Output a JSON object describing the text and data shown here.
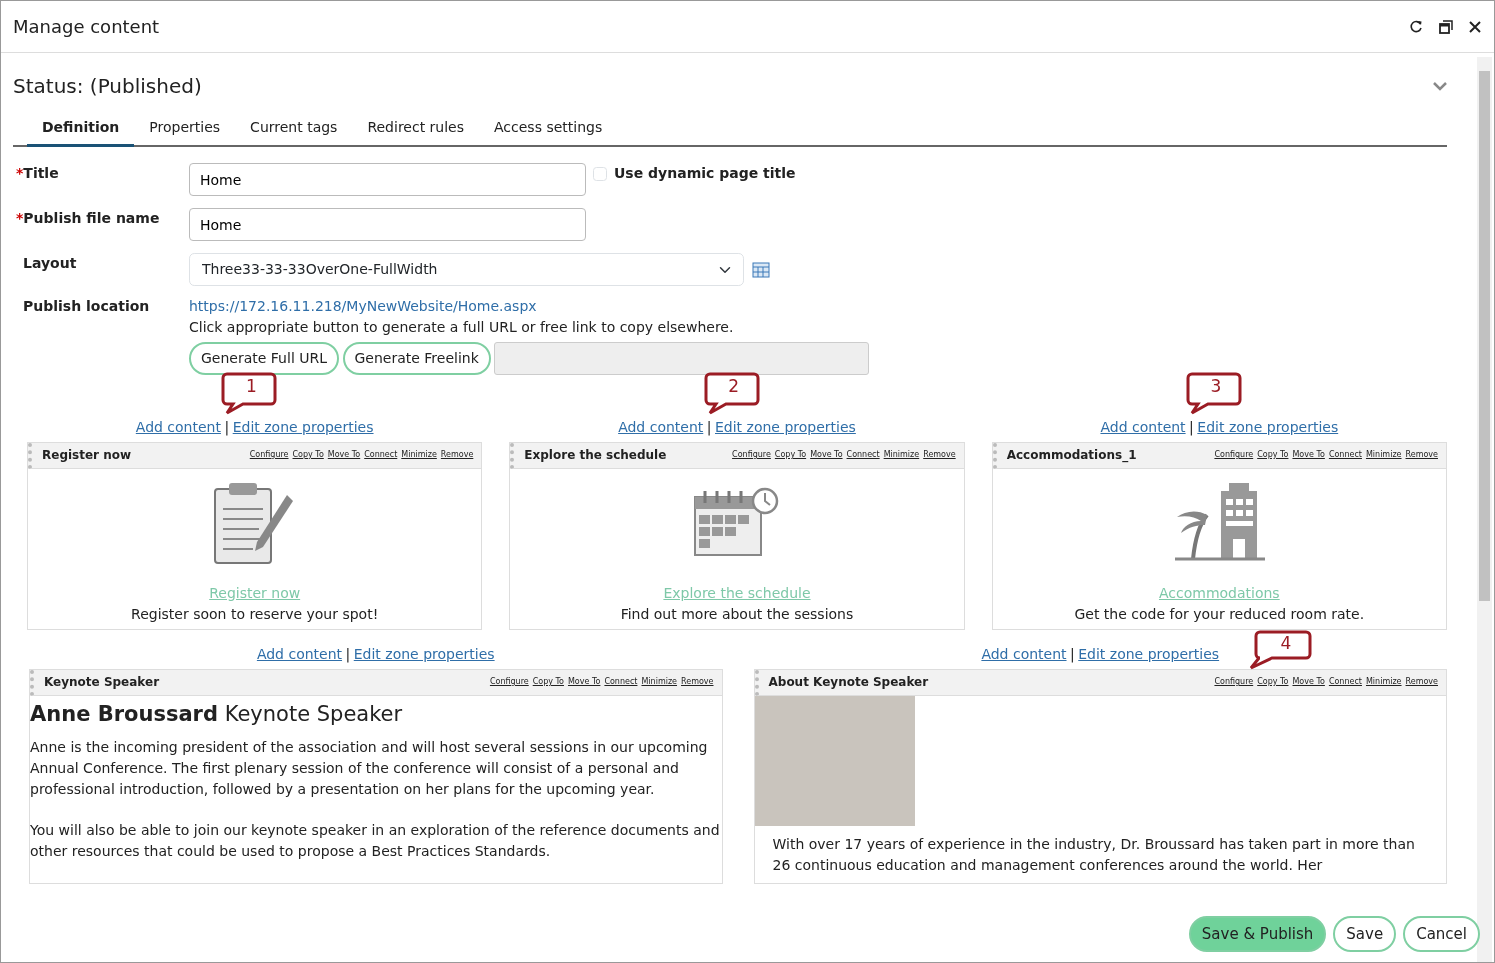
{
  "window": {
    "title": "Manage content"
  },
  "status": {
    "title": "Status: (Published)"
  },
  "tabs": [
    {
      "label": "Definition",
      "selected": true
    },
    {
      "label": "Properties",
      "selected": false
    },
    {
      "label": "Current tags",
      "selected": false
    },
    {
      "label": "Redirect rules",
      "selected": false
    },
    {
      "label": "Access settings",
      "selected": false
    }
  ],
  "form": {
    "title": {
      "required_mark": "*",
      "label": "Title",
      "value": "Home"
    },
    "dynamic_title": {
      "label": "Use dynamic page title",
      "checked": false
    },
    "publish_file_name": {
      "required_mark": "*",
      "label": "Publish file name",
      "value": "Home"
    },
    "layout": {
      "label": "Layout",
      "value": "Three33-33-33OverOne-FullWidth"
    },
    "publish_location": {
      "label": "Publish location",
      "url": "https://172.16.11.218/MyNewWebsite/Home.aspx",
      "hint": "Click appropriate button to generate a full URL or free link to copy elsewhere.",
      "buttons": [
        "Generate Full URL",
        "Generate Freelink"
      ]
    }
  },
  "top_zones": [
    {
      "links": [
        "Add content",
        "Edit zone properties"
      ],
      "separator": "|",
      "callout": "1",
      "webpart": {
        "title": "Register now",
        "actions": [
          "Configure",
          "Copy To",
          "Move To",
          "Connect",
          "Minimize",
          "Remove"
        ],
        "kind": "clipboard",
        "link": "Register now",
        "description": "Register soon to reserve your spot!"
      }
    },
    {
      "links": [
        "Add content",
        "Edit zone properties"
      ],
      "separator": "|",
      "callout": "2",
      "webpart": {
        "title": "Explore the schedule",
        "actions": [
          "Configure",
          "Copy To",
          "Move To",
          "Connect",
          "Minimize",
          "Remove"
        ],
        "kind": "calendar",
        "link": "Explore the schedule",
        "description": "Find out more about the sessions"
      }
    },
    {
      "links": [
        "Add content",
        "Edit zone properties"
      ],
      "separator": "|",
      "callout": "3",
      "webpart": {
        "title": "Accommodations_1",
        "actions": [
          "Configure",
          "Copy To",
          "Move To",
          "Connect",
          "Minimize",
          "Remove"
        ],
        "kind": "hotel",
        "link": "Accommodations",
        "description": "Get the code for your reduced room rate."
      }
    }
  ],
  "bottom_zones": [
    {
      "links": [
        "Add content",
        "Edit zone properties"
      ],
      "separator": "|",
      "webpart": {
        "kind": "article",
        "title": "Keynote Speaker",
        "actions": [
          "Configure",
          "Copy To",
          "Move To",
          "Connect",
          "Minimize",
          "Remove"
        ],
        "heading": "**Anne Broussard** Keynote Speaker",
        "paragraphs": [
          "Anne is the incoming president of the association and will host several sessions in our upcoming Annual Conference. The first plenary session of the conference will consist of a personal and professional introduction, followed by a presentation on her plans for the upcoming year.",
          "You will also be able to join our keynote speaker in an exploration of the reference documents and other resources that could be used to propose a Best Practices Standards."
        ]
      }
    },
    {
      "links": [
        "Add content",
        "Edit zone properties"
      ],
      "separator": "|",
      "callout": "4",
      "webpart": {
        "kind": "bio",
        "title": "About Keynote Speaker",
        "actions": [
          "Configure",
          "Copy To",
          "Move To",
          "Connect",
          "Minimize",
          "Remove"
        ],
        "paragraphs": [
          "With over 17 years of experience in the industry, Dr. Broussard has taken part in more than 26 continuous education and management conferences around the world. Her"
        ]
      }
    }
  ],
  "footer": {
    "buttons": [
      {
        "label": "Save & Publish",
        "kind": "primary"
      },
      {
        "label": "Save",
        "kind": "outline"
      },
      {
        "label": "Cancel",
        "kind": "outline"
      }
    ]
  }
}
